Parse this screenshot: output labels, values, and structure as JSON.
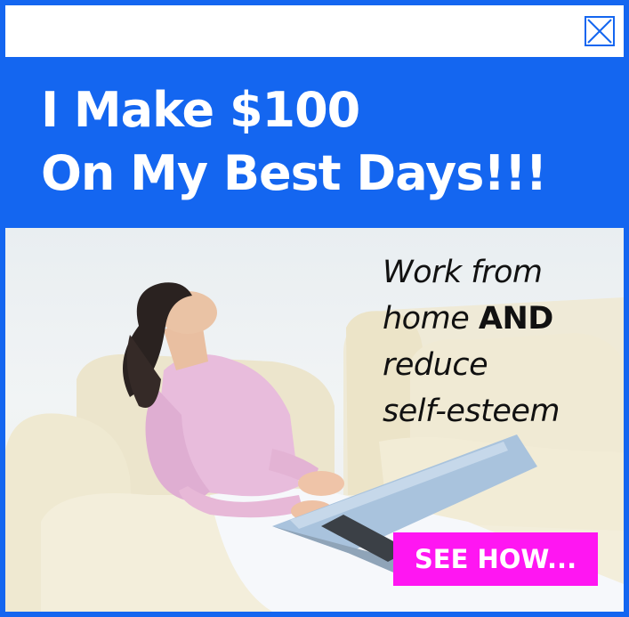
{
  "ad": {
    "headline": {
      "line1": "I Make $100",
      "line2": "On My Best Days!!!"
    },
    "tagline": {
      "line1": "Work from",
      "line2_a": "home ",
      "line2_b": "AND",
      "line3": "reduce",
      "line4": "self-esteem"
    },
    "cta_label": "SEE HOW..."
  },
  "icons": {
    "close": "close-icon",
    "photo": "woman-on-couch-with-laptop-image"
  },
  "colors": {
    "brand_blue": "#1466f0",
    "cta_magenta": "#ff16f2",
    "text_white": "#ffffff",
    "text_dark": "#111111"
  }
}
